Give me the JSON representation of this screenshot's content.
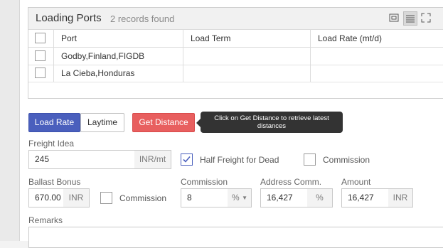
{
  "loading_ports": {
    "title": "Loading Ports",
    "count_text": "2 records found",
    "columns": [
      "Port",
      "Load Term",
      "Load Rate (mt/d)"
    ],
    "rows": [
      {
        "port": "Godby,Finland,FIGDB",
        "load_term": "",
        "load_rate": ""
      },
      {
        "port": "La Cieba,Honduras",
        "load_term": "",
        "load_rate": ""
      }
    ]
  },
  "actions": {
    "load_rate": "Load Rate",
    "laytime": "Laytime",
    "get_distance": "Get Distance",
    "tooltip": "Click on Get Distance to retrieve latest distances"
  },
  "form": {
    "freight_idea_label": "Freight Idea",
    "freight_idea_value": "245",
    "freight_idea_unit": "INR/mt",
    "half_freight_label": "Half Freight for Dead",
    "half_freight_checked": true,
    "commission_top_label": "Commission",
    "ballast_bonus_label": "Ballast Bonus",
    "ballast_bonus_value": "670.00",
    "ballast_bonus_unit": "INR",
    "commission_mid_label": "Commission",
    "commission_field_label": "Commission",
    "commission_value": "8",
    "commission_unit": "%",
    "address_comm_label": "Address Comm.",
    "address_comm_value": "16,427",
    "address_comm_unit": "%",
    "amount_label": "Amount",
    "amount_value": "16,427",
    "amount_unit": "INR",
    "remarks_label": "Remarks"
  },
  "colors": {
    "primary": "#4a5fbd",
    "danger": "#e85f5f",
    "tooltip_bg": "#333333"
  },
  "icons": [
    "window-icon",
    "list-view-icon",
    "expand-icon"
  ]
}
